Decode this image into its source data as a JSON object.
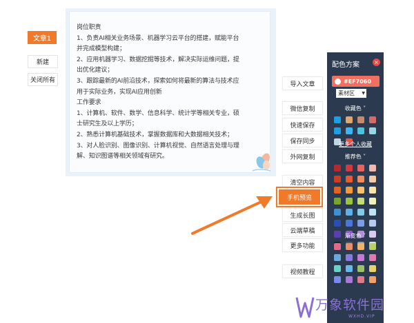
{
  "left_panel": {
    "tab_label": "文章1",
    "buttons": [
      "新建",
      "关闭所有"
    ]
  },
  "editor": {
    "lines": [
      "岗位职责",
      "1、负责AI相关业务场景、机器学习云平台的搭建，赋能平台",
      "并完成模型构建；",
      "2、应用机器学习、数据挖掘等技术，解决实际运维问题，提",
      "出优化建议；",
      "3、跟踪最新的AI前沿技术，探索如何将最新的算法与技术应",
      "用于实际业务，实现AI应用创新",
      "工作要求",
      "1、计算机、软件、数学、信息科学、统计学等相关专业，硕",
      "士研究生及以上学历；",
      "2、熟悉计算机基础技术，掌握数据库和大数据相关技术；",
      "3、对人脸识别、图像识别、计算机视觉、自然语言处理与理",
      "解、知识图谱等相关领域有研究。"
    ]
  },
  "toolbar": {
    "buttons": [
      "导入文章",
      "微信复制",
      "快速保存",
      "保存同步",
      "外网复制",
      "清空内容",
      "生成长图",
      "云端草稿",
      "更多功能",
      "视频教程"
    ],
    "highlight_label": "手机预览"
  },
  "color_panel": {
    "title": "配色方案",
    "close_symbol": "×",
    "hex_value": "#EF7060",
    "material_select": "素材区",
    "section_favorites": "收藏色",
    "more_favorites_link": "更多个人收藏",
    "section_recommended": "推荐色",
    "section_gradient": "渐变色",
    "accent_color": "#ef7060",
    "favorite_colors": [
      "#1e9de0",
      "#e0a66a",
      "#c98a6b",
      "#d46a6a",
      "#1e9de0",
      "#3eb5f0",
      "#4cc2e0",
      "#9ad5e6",
      "#c0d6e4",
      "#e0584f"
    ],
    "recommended_colors": [
      "#b8282b",
      "#d3383b",
      "#e8635f",
      "#f3b9ac",
      "#cc3d24",
      "#e75b32",
      "#f08c5e",
      "#f7c9a8",
      "#e8601f",
      "#f29a38",
      "#f6c26a",
      "#fce3a9",
      "#7aa52b",
      "#9dc441",
      "#c5dc74",
      "#f0f2b9",
      "#3f8fd4",
      "#5fb0e8",
      "#82c8ec",
      "#bfe3f4",
      "#2a4fb3",
      "#4a76d6",
      "#7b9de6",
      "#b9cbf2",
      "#5b3fb0",
      "#8a5ccc",
      "#b48de0",
      "#dcc8f0",
      "#222222",
      "#555555",
      "#999999",
      "#dddddd"
    ],
    "gradient_colors": [
      "#e06a8a",
      "#e88f6a",
      "#f0b36a",
      "#b6d06a",
      "#6aa8e0",
      "#8a7ae0",
      "#c67ad8",
      "#e07ab0",
      "#6ad0c8",
      "#6ab8e8",
      "#9ac06a",
      "#e8d06a",
      "#7a8ae8",
      "#a87ad8",
      "#e07a8a",
      "#f0a06a"
    ]
  },
  "watermark": {
    "text": "万象软件园",
    "sub": "WXHD.VIP"
  }
}
